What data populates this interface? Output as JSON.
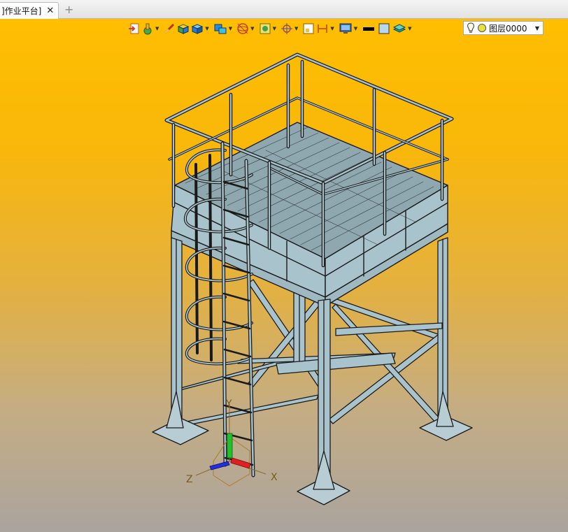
{
  "tab": {
    "title": "]作业平台]"
  },
  "toolbar": {
    "icons": [
      "exit-sketch-icon",
      "sketch-icon",
      "line-tool-icon",
      "box-icon",
      "cube-icon",
      "extrude-icon",
      "sphere-wire-icon",
      "shaded-frame-icon",
      "target-icon",
      "frame-icon",
      "dimension-icon",
      "display-icon",
      "line-color-icon",
      "fill-color-icon",
      "layer-stack-icon"
    ]
  },
  "layer": {
    "name": "图层0000"
  },
  "axes": {
    "x": "X",
    "y": "Y",
    "z": "Z"
  },
  "colors": {
    "viewport_top": "#ffbe00",
    "viewport_bottom": "#aaa49e",
    "steel": "#a9c3cc",
    "outline": "#1a1a1a"
  }
}
